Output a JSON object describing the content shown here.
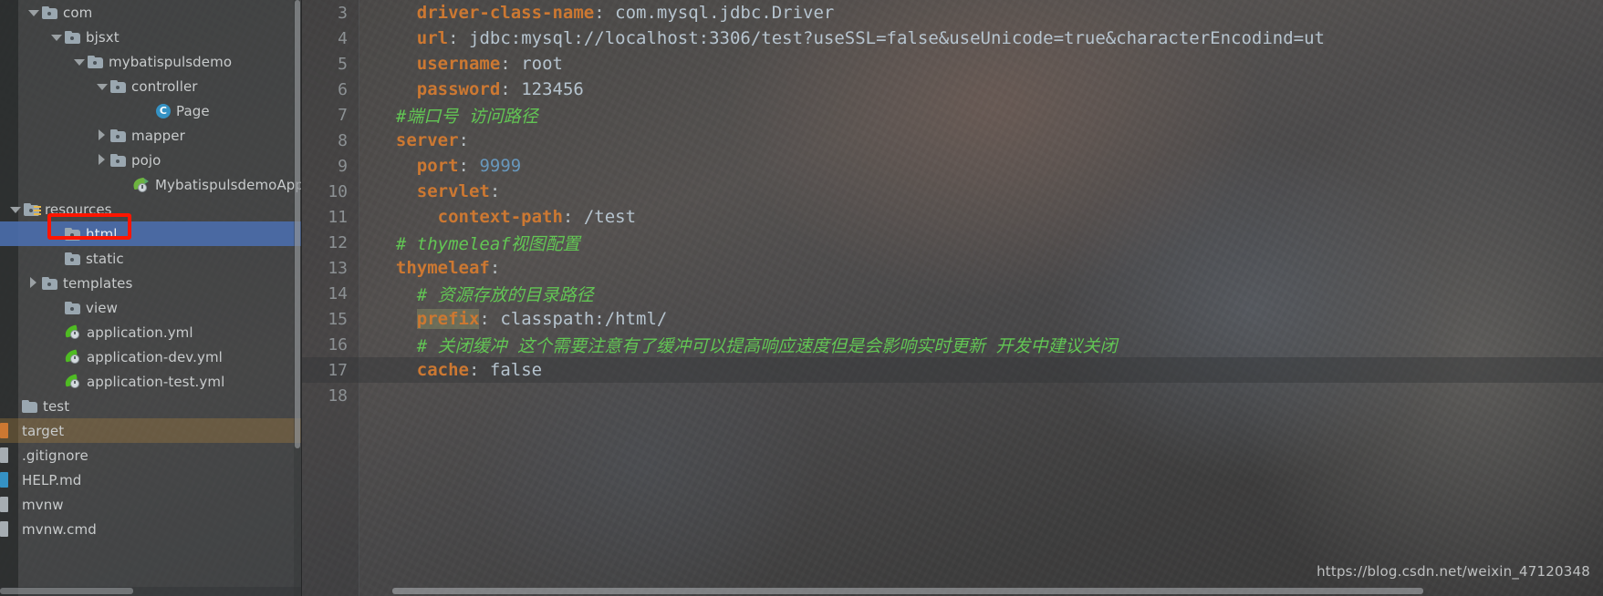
{
  "project_tree": {
    "scrollbar": {
      "name": "tree-vertical-scrollbar"
    },
    "items": [
      {
        "label": "com",
        "indent": 30,
        "arrow": "down",
        "icon": "folder",
        "state": "normal"
      },
      {
        "label": "bjsxt",
        "indent": 55,
        "arrow": "down",
        "icon": "folder",
        "state": "normal"
      },
      {
        "label": "mybatispulsdemo",
        "indent": 80,
        "arrow": "down",
        "icon": "folder",
        "state": "normal"
      },
      {
        "label": "controller",
        "indent": 105,
        "arrow": "down",
        "icon": "folder",
        "state": "normal"
      },
      {
        "label": "Page",
        "indent": 155,
        "arrow": "none",
        "icon": "class",
        "state": "normal"
      },
      {
        "label": "mapper",
        "indent": 105,
        "arrow": "right",
        "icon": "folder",
        "state": "normal"
      },
      {
        "label": "pojo",
        "indent": 105,
        "arrow": "right",
        "icon": "folder",
        "state": "normal"
      },
      {
        "label": "MybatispulsdemoApplicati",
        "indent": 130,
        "arrow": "none",
        "icon": "spring",
        "state": "normal"
      },
      {
        "label": "resources",
        "indent": 10,
        "arrow": "down",
        "icon": "folder-resources",
        "state": "normal"
      },
      {
        "label": "html",
        "indent": 55,
        "arrow": "none",
        "icon": "folder",
        "state": "selected"
      },
      {
        "label": "static",
        "indent": 55,
        "arrow": "none",
        "icon": "folder",
        "state": "normal"
      },
      {
        "label": "templates",
        "indent": 30,
        "arrow": "right",
        "icon": "folder",
        "state": "normal"
      },
      {
        "label": "view",
        "indent": 55,
        "arrow": "none",
        "icon": "folder",
        "state": "normal"
      },
      {
        "label": "application.yml",
        "indent": 55,
        "arrow": "none",
        "icon": "yml",
        "state": "normal"
      },
      {
        "label": "application-dev.yml",
        "indent": 55,
        "arrow": "none",
        "icon": "yml",
        "state": "normal"
      },
      {
        "label": "application-test.yml",
        "indent": 55,
        "arrow": "none",
        "icon": "yml",
        "state": "normal"
      },
      {
        "label": "test",
        "indent": 8,
        "arrow": "none",
        "icon": "folder-plain",
        "state": "normal"
      },
      {
        "label": "target",
        "indent": 8,
        "arrow": "none",
        "icon": "edge-orange",
        "state": "hl-orange"
      },
      {
        "label": ".gitignore",
        "indent": 8,
        "arrow": "none",
        "icon": "edge-gray",
        "state": "normal"
      },
      {
        "label": "HELP.md",
        "indent": 8,
        "arrow": "none",
        "icon": "edge-cyan",
        "state": "normal"
      },
      {
        "label": "mvnw",
        "indent": 8,
        "arrow": "none",
        "icon": "edge-gray",
        "state": "normal"
      },
      {
        "label": "mvnw.cmd",
        "indent": 8,
        "arrow": "none",
        "icon": "edge-gray",
        "state": "normal"
      }
    ]
  },
  "annotation": {
    "name": "red-highlight-box-around-html-folder"
  },
  "editor": {
    "lines": [
      {
        "no": "3",
        "indent": 4,
        "key": "driver-class-name",
        "value": "com.mysql.jdbc.Driver",
        "type": "pair",
        "current": false
      },
      {
        "no": "4",
        "indent": 4,
        "key": "url",
        "value": "jdbc:mysql://localhost:3306/test?useSSL=false&useUnicode=true&characterEncodind=ut",
        "type": "pair",
        "current": false
      },
      {
        "no": "5",
        "indent": 4,
        "key": "username",
        "value": "root",
        "type": "pair",
        "current": false
      },
      {
        "no": "6",
        "indent": 4,
        "key": "password",
        "value": "123456",
        "type": "pair",
        "current": false
      },
      {
        "no": "7",
        "indent": 2,
        "text": "#端口号 访问路径",
        "type": "comment",
        "current": false
      },
      {
        "no": "8",
        "indent": 2,
        "key": "server",
        "value": "",
        "type": "pair",
        "current": false
      },
      {
        "no": "9",
        "indent": 4,
        "key": "port",
        "value": "9999",
        "vtype": "number",
        "type": "pair",
        "current": false
      },
      {
        "no": "10",
        "indent": 4,
        "key": "servlet",
        "value": "",
        "type": "pair",
        "current": false
      },
      {
        "no": "11",
        "indent": 6,
        "key": "context-path",
        "value": "/test",
        "type": "pair",
        "current": false
      },
      {
        "no": "12",
        "indent": 2,
        "text": "# thymeleaf视图配置",
        "type": "comment",
        "current": false
      },
      {
        "no": "13",
        "indent": 2,
        "key": "thymeleaf",
        "value": "",
        "type": "pair",
        "current": false
      },
      {
        "no": "14",
        "indent": 4,
        "text": "# 资源存放的目录路径",
        "type": "comment",
        "current": false
      },
      {
        "no": "15",
        "indent": 4,
        "key": "prefix",
        "value": "classpath:/html/",
        "type": "pair",
        "highlight_key": true,
        "current": false
      },
      {
        "no": "16",
        "indent": 4,
        "text": "# 关闭缓冲 这个需要注意有了缓冲可以提高响应速度但是会影响实时更新 开发中建议关闭",
        "type": "comment",
        "current": false
      },
      {
        "no": "17",
        "indent": 4,
        "key": "cache",
        "value": "false",
        "type": "pair",
        "current": true
      },
      {
        "no": "18",
        "indent": 0,
        "text": "",
        "type": "blank",
        "current": false
      }
    ]
  },
  "watermark": {
    "text": "https://blog.csdn.net/weixin_47120348"
  },
  "colors": {
    "key": "#cc7832",
    "value": "#b6c4cf",
    "number": "#6897bb",
    "comment": "#62c554",
    "selection": "#4b6eaf",
    "annotation": "#ff1500",
    "gutter_text": "#8c9194"
  }
}
